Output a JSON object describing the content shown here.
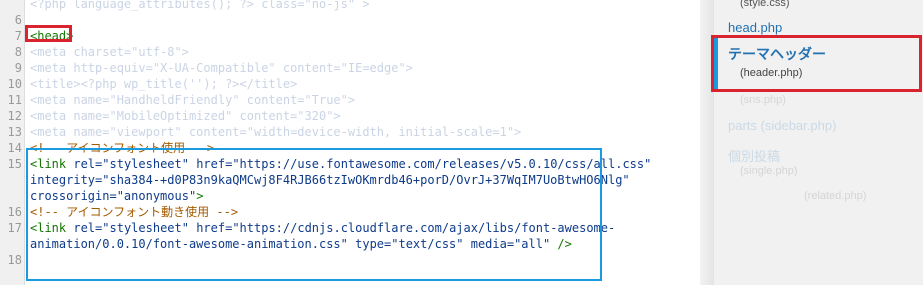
{
  "editor": {
    "lines": [
      {
        "n": "",
        "faded": true,
        "parts": [
          {
            "t": "<?php language_attributes(); ?> class=\"no-js\" >",
            "c": "plain"
          }
        ]
      },
      {
        "n": "6",
        "faded": true,
        "parts": [
          {
            "t": "",
            "c": "plain"
          }
        ]
      },
      {
        "n": "7",
        "faded": false,
        "parts": [
          {
            "t": "<head>",
            "c": "tag"
          }
        ]
      },
      {
        "n": "8",
        "faded": true,
        "parts": [
          {
            "t": "<meta charset=\"utf-8\">",
            "c": "plain"
          }
        ]
      },
      {
        "n": "9",
        "faded": true,
        "parts": [
          {
            "t": "<meta http-equiv=\"X-UA-Compatible\" content=\"IE=edge\">",
            "c": "plain"
          }
        ]
      },
      {
        "n": "10",
        "faded": true,
        "parts": [
          {
            "t": "<title><?php wp_title(''); ?></title>",
            "c": "plain"
          }
        ]
      },
      {
        "n": "11",
        "faded": true,
        "parts": [
          {
            "t": "<meta name=\"HandheldFriendly\" content=\"True\">",
            "c": "plain"
          }
        ]
      },
      {
        "n": "12",
        "faded": true,
        "parts": [
          {
            "t": "<meta name=\"MobileOptimized\" content=\"320\">",
            "c": "plain"
          }
        ]
      },
      {
        "n": "13",
        "faded": true,
        "parts": [
          {
            "t": "<meta name=\"viewport\" content=\"width=device-width, initial-scale=1\">",
            "c": "plain"
          }
        ]
      },
      {
        "n": "14",
        "faded": false,
        "parts": [
          {
            "t": "<!-- アイコンフォント使用 -->",
            "c": "cmt"
          }
        ]
      },
      {
        "n": "15",
        "faded": false,
        "parts": [
          {
            "t": "<link ",
            "c": "tag"
          },
          {
            "t": "rel=",
            "c": "attr"
          },
          {
            "t": "\"stylesheet\"",
            "c": "str"
          },
          {
            "t": " href=",
            "c": "attr"
          },
          {
            "t": "\"https://use.fontawesome.com/releases/v5.0.10/css/all.css\"",
            "c": "str"
          }
        ]
      },
      {
        "n": "",
        "faded": false,
        "parts": [
          {
            "t": "integrity=",
            "c": "attr"
          },
          {
            "t": "\"sha384-+d0P83n9kaQMCwj8F4RJB66tzIwOKmrdb46+porD/OvrJ+37WqIM7UoBtwHO6Nlg\"",
            "c": "str"
          }
        ]
      },
      {
        "n": "",
        "faded": false,
        "parts": [
          {
            "t": "crossorigin=",
            "c": "attr"
          },
          {
            "t": "\"anonymous\"",
            "c": "str"
          },
          {
            "t": ">",
            "c": "tag"
          }
        ]
      },
      {
        "n": "16",
        "faded": false,
        "parts": [
          {
            "t": "<!-- アイコンフォント動き使用 -->",
            "c": "cmt"
          }
        ]
      },
      {
        "n": "17",
        "faded": false,
        "parts": [
          {
            "t": "<link ",
            "c": "tag"
          },
          {
            "t": "rel=",
            "c": "attr"
          },
          {
            "t": "\"stylesheet\"",
            "c": "str"
          },
          {
            "t": " href=",
            "c": "attr"
          },
          {
            "t": "\"https://cdnjs.cloudflare.com/ajax/libs/font-awesome-",
            "c": "str"
          }
        ]
      },
      {
        "n": "",
        "faded": false,
        "parts": [
          {
            "t": "animation/0.0.10/font-awesome-animation.css\"",
            "c": "str"
          },
          {
            "t": " type=",
            "c": "attr"
          },
          {
            "t": "\"text/css\"",
            "c": "str"
          },
          {
            "t": " media=",
            "c": "attr"
          },
          {
            "t": "\"all\"",
            "c": "str"
          },
          {
            "t": " />",
            "c": "tag"
          }
        ]
      },
      {
        "n": "18",
        "faded": false,
        "parts": [
          {
            "t": "",
            "c": "plain"
          }
        ]
      }
    ]
  },
  "sidebar": {
    "style_css_sub": "(style.css)",
    "head_php": "head.php",
    "current_label": "テーマヘッダー",
    "current_sub": "(header.php)",
    "faded_items": [
      "(sns.php)",
      "parts (sidebar.php)",
      "個別投稿",
      "(single.php)",
      "(related.php)"
    ]
  },
  "colors": {
    "highlight_red": "#d9232e",
    "highlight_blue": "#1a9be0",
    "link_blue": "#2271b1"
  }
}
